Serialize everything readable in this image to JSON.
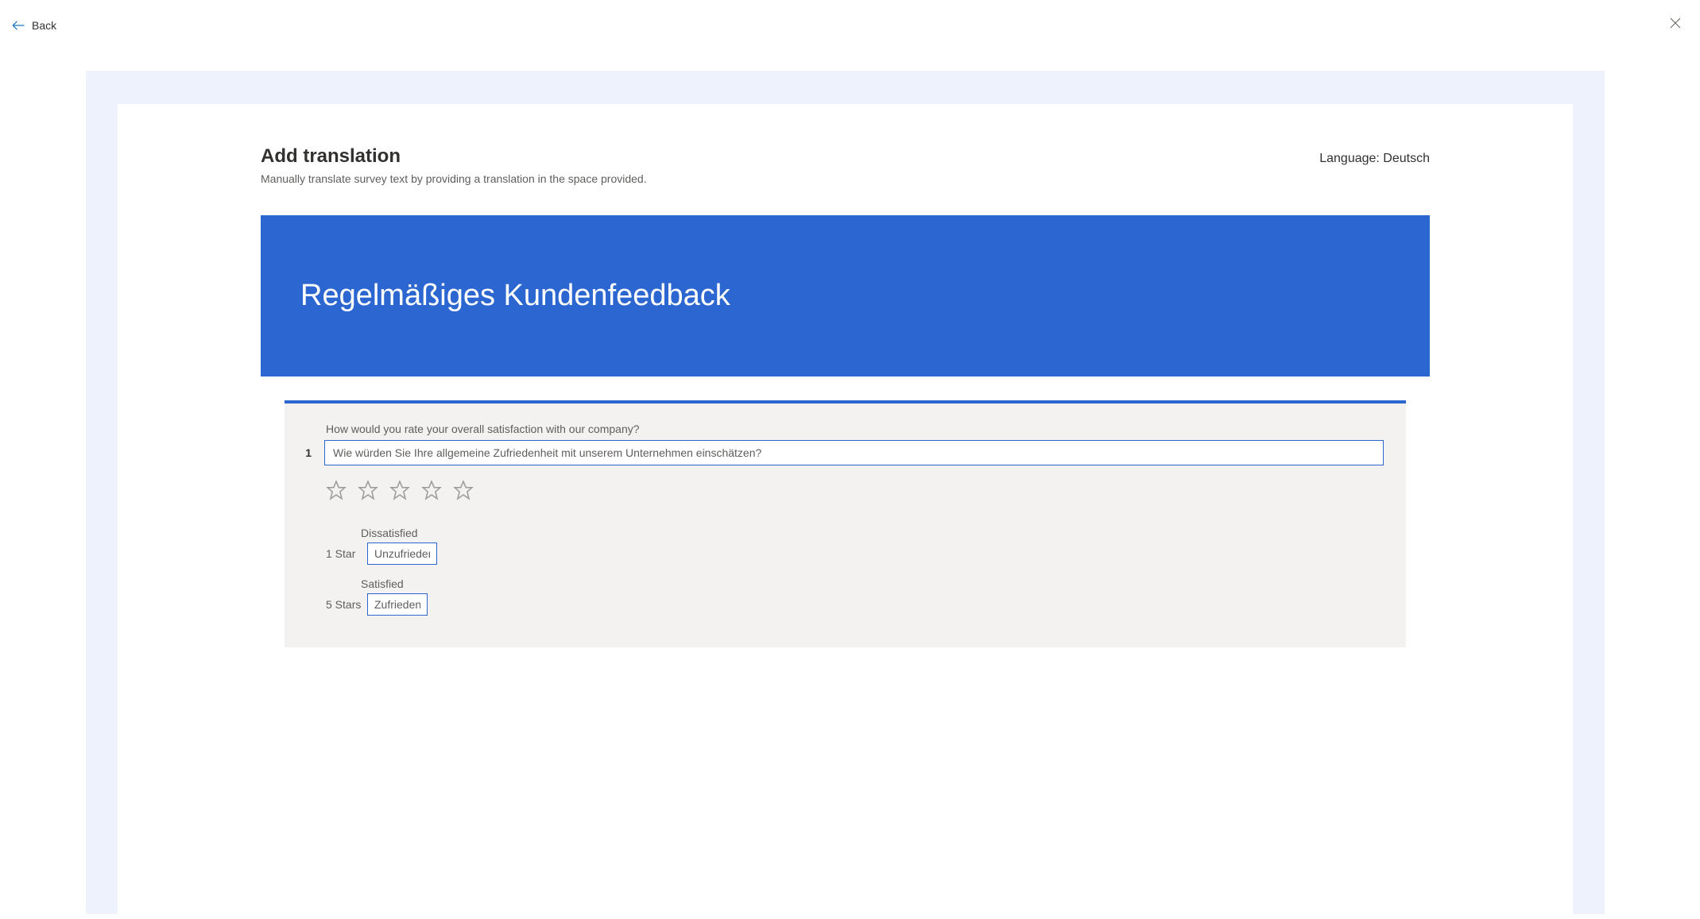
{
  "topbar": {
    "back_label": "Back"
  },
  "header": {
    "title": "Add translation",
    "subtitle": "Manually translate survey text by providing a translation in the space provided.",
    "language_prefix": "Language: ",
    "language_value": "Deutsch"
  },
  "banner": {
    "title": "Regelmäßiges Kundenfeedback"
  },
  "question": {
    "number": "1",
    "source_text": "How would you rate your overall satisfaction with our company?",
    "translation_value": "Wie würden Sie Ihre allgemeine Zufriedenheit mit unserem Unternehmen einschätzen?",
    "rating_labels": [
      {
        "key": "1 Star",
        "source": "Dissatisfied",
        "translation": "Unzufrieden"
      },
      {
        "key": "5 Stars",
        "source": "Satisfied",
        "translation": "Zufrieden"
      }
    ]
  }
}
